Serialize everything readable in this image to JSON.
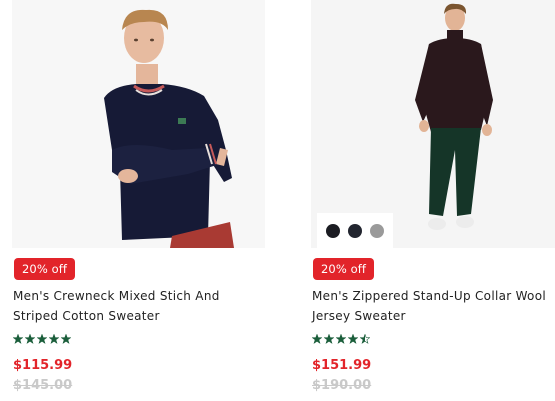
{
  "colors": {
    "badge": "#e2242a",
    "sale_price": "#e2242a",
    "old_price": "#c9c9c9",
    "stars": "#1b5e3b",
    "product_1_sweater": "#161a36",
    "product_2_sweater": "#2a181c",
    "product_2_pants": "#153528"
  },
  "products": [
    {
      "image_alt": "Men's Crewneck Mixed Stich And Striped Cotton Sweater",
      "discount_badge": "20% off",
      "name_line_1": "Men's Crewneck Mixed Stich And",
      "name_line_2": "Striped Cotton Sweater",
      "rating": 5,
      "sale_price": "$115.99",
      "original_price": "$145.00"
    },
    {
      "image_alt": "Men's Zippered Stand-Up Collar Wool Jersey Sweater",
      "discount_badge": "20% off",
      "name_line_1": "Men's Zippered Stand-Up Collar Wool",
      "name_line_2": "Jersey Sweater",
      "rating": 4.5,
      "swatches": [
        "#1b1c22",
        "#22252f",
        "#9a9a9a"
      ],
      "sale_price": "$151.99",
      "original_price": "$190.00"
    }
  ]
}
